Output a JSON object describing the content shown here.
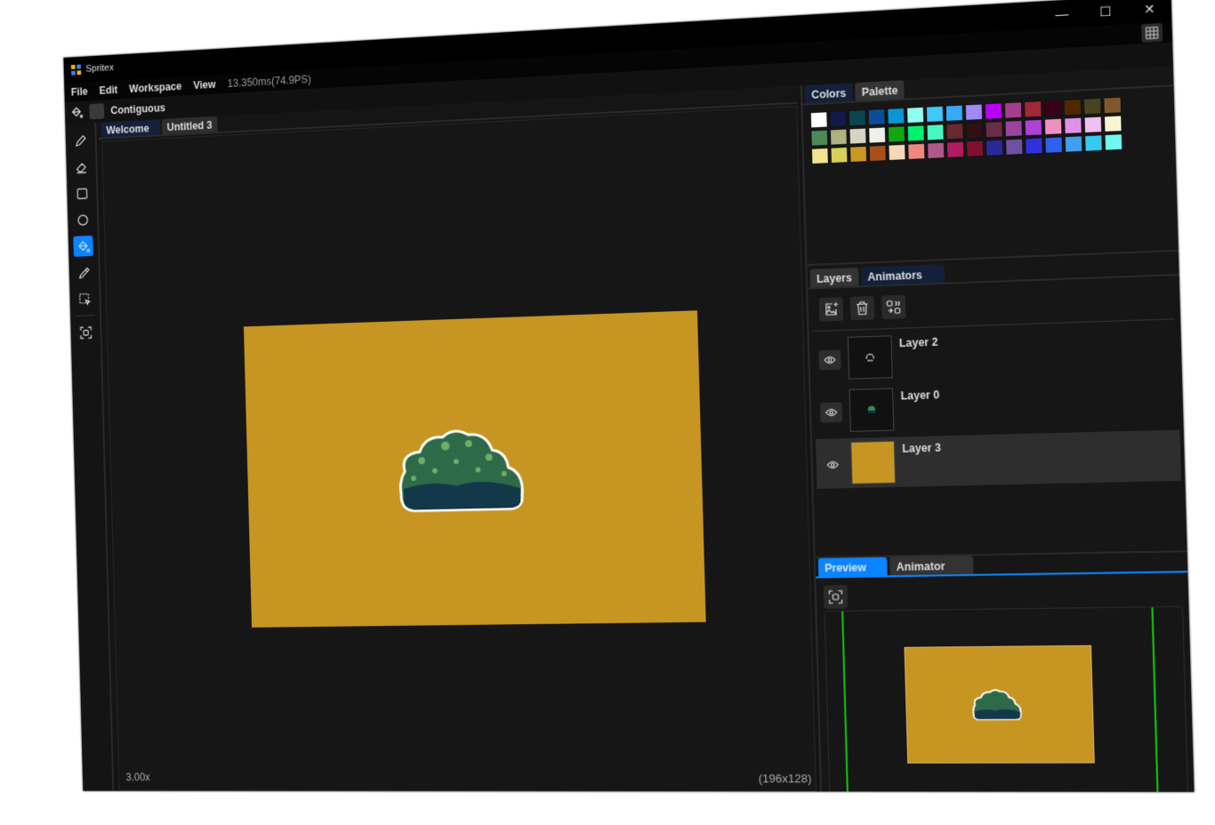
{
  "app": {
    "title": "Spritex",
    "window_controls": [
      "—",
      "☐",
      "✕"
    ]
  },
  "menu": {
    "items": [
      "File",
      "Edit",
      "Workspace",
      "View"
    ],
    "frame_time": "13.350ms(74.9PS)"
  },
  "options": {
    "contiguous_label": "Contiguous",
    "contiguous_checked": false
  },
  "tools": [
    "pencil-tool",
    "eraser-tool",
    "rectangle-tool",
    "ellipse-tool",
    "fill-tool",
    "eyedropper-tool",
    "selection-tool",
    "fit-view-tool"
  ],
  "active_tool": "fill-tool",
  "editor": {
    "tabs": [
      "Welcome",
      "Untitled 3"
    ],
    "active_tab": "Untitled 3",
    "zoom": "3.00x",
    "size": "(196x128)",
    "background_color": "#c79522"
  },
  "color_panel": {
    "tabs": [
      "Colors",
      "Palette"
    ],
    "active_tab": "Palette",
    "palette": [
      "#ffffff",
      "#111a4a",
      "#0a4650",
      "#0a4c9a",
      "#0896d4",
      "#90fff0",
      "#40c8f8",
      "#38a8f8",
      "#a088f8",
      "#b800f8",
      "#a83c8c",
      "#a02838",
      "#3a0018",
      "#502800",
      "#484420",
      "#805830",
      "#4a8a58",
      "#b0b080",
      "#d8d4c4",
      "#f0f0ea",
      "#10a810",
      "#00f070",
      "#48f8c0",
      "#6a2830",
      "#301014",
      "#6a2c48",
      "#9c449c",
      "#b040d8",
      "#f090c0",
      "#e090e8",
      "#f0c0f0",
      "#f8f4d0",
      "#f0e490",
      "#d8d058",
      "#c89820",
      "#a85018",
      "#f4d8b8",
      "#f08880",
      "#b05888",
      "#b01c60",
      "#801030",
      "#2a2898",
      "#7050a0",
      "#3030e0",
      "#3060f0",
      "#40a0f0",
      "#38c8f0",
      "#70f8f0"
    ]
  },
  "layers_panel": {
    "tabs": [
      "Layers",
      "Animators"
    ],
    "active_tab": "Layers",
    "layers": [
      {
        "name": "Layer 2",
        "visible": true
      },
      {
        "name": "Layer 0",
        "visible": true
      },
      {
        "name": "Layer 3",
        "visible": true,
        "selected": true
      }
    ]
  },
  "preview_panel": {
    "tabs": [
      "Preview",
      "Animator"
    ],
    "active_tab": "Preview"
  }
}
